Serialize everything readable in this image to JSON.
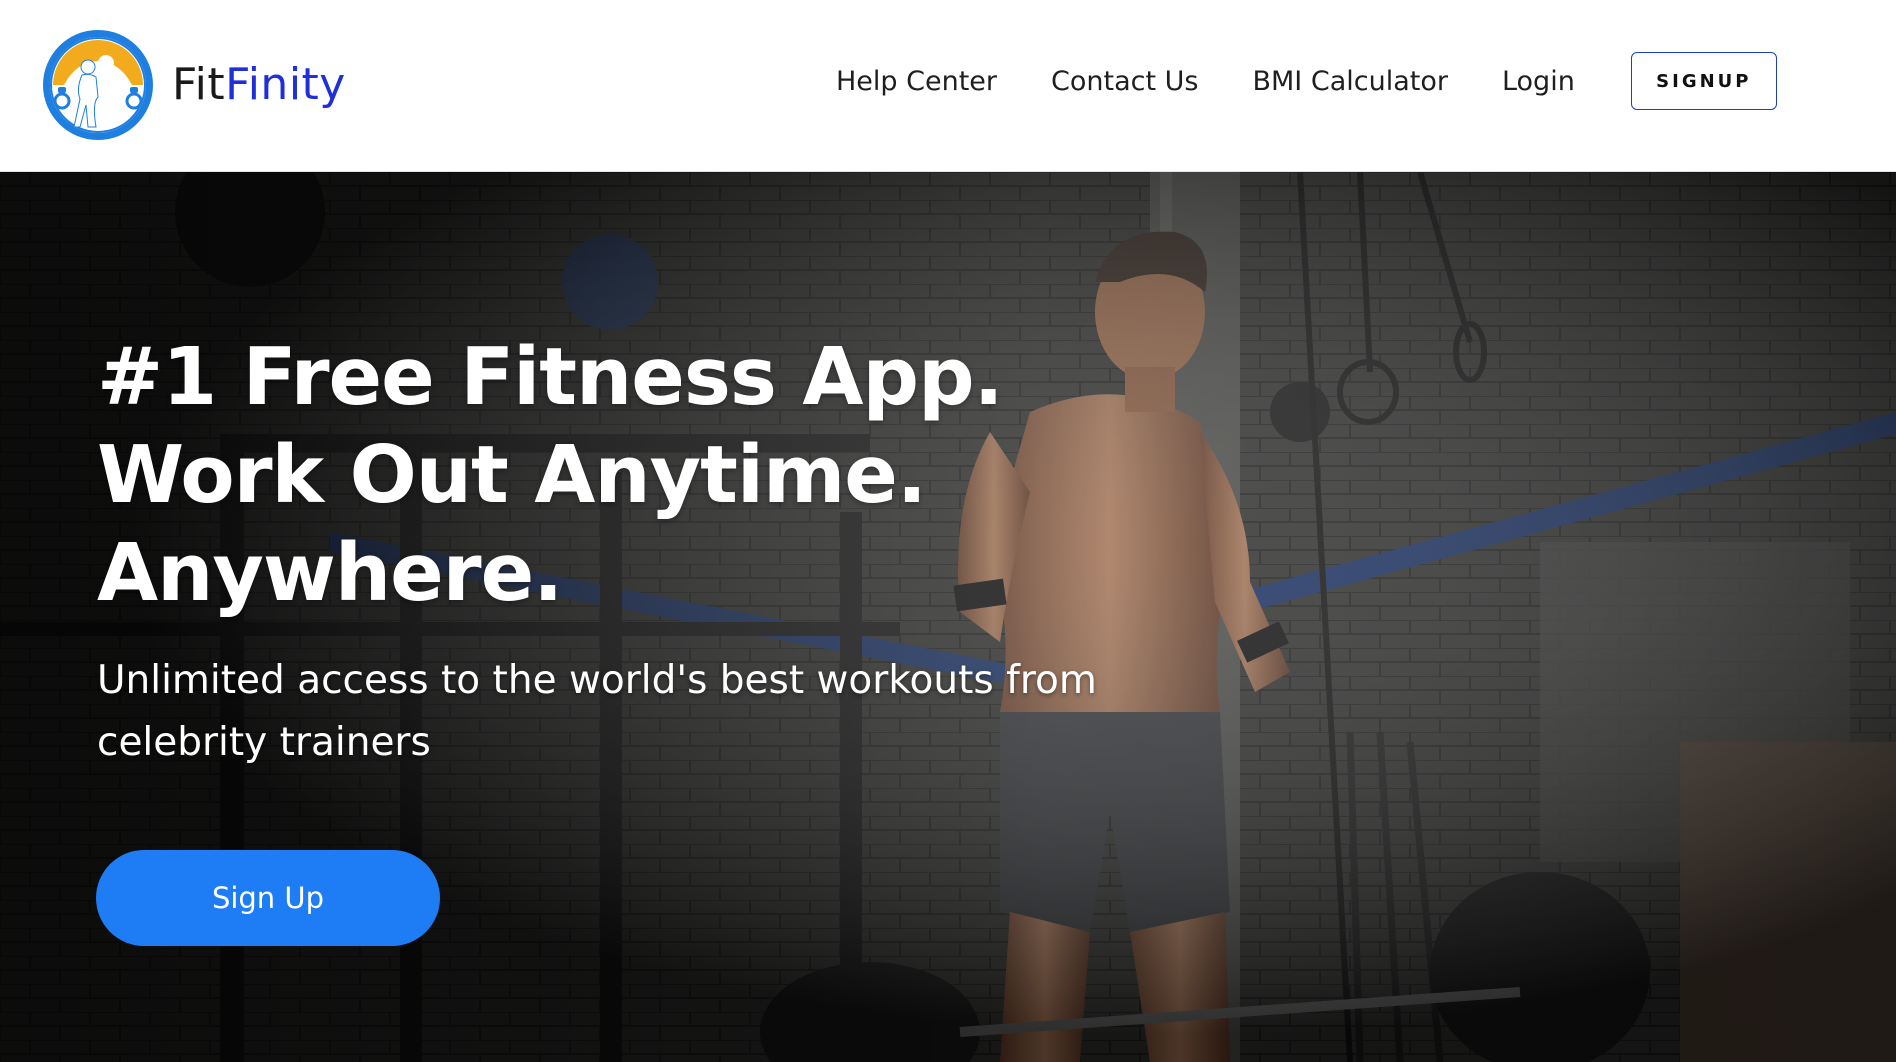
{
  "brand": {
    "name_part1": "Fit",
    "name_part2": "Finity",
    "logo_icon": "fitness-logo-icon",
    "colors": {
      "part1": "#1a1a1a",
      "part2": "#1f2fd9",
      "logo_ring": "#1f7fe0",
      "logo_fill": "#f1ab1c"
    }
  },
  "nav": {
    "links": [
      {
        "label": "Help Center"
      },
      {
        "label": "Contact Us"
      },
      {
        "label": "BMI Calculator"
      },
      {
        "label": "Login"
      }
    ],
    "signup_label": "SIGNUP"
  },
  "hero": {
    "headline": [
      "#1 Free Fitness App.",
      "Work Out Anytime.",
      "Anywhere."
    ],
    "subheadline": "Unlimited access to the world's best workouts from celebrity trainers",
    "cta_label": "Sign Up",
    "cta_color": "#1e7cf5",
    "background_image": "gym-athlete-photo"
  }
}
